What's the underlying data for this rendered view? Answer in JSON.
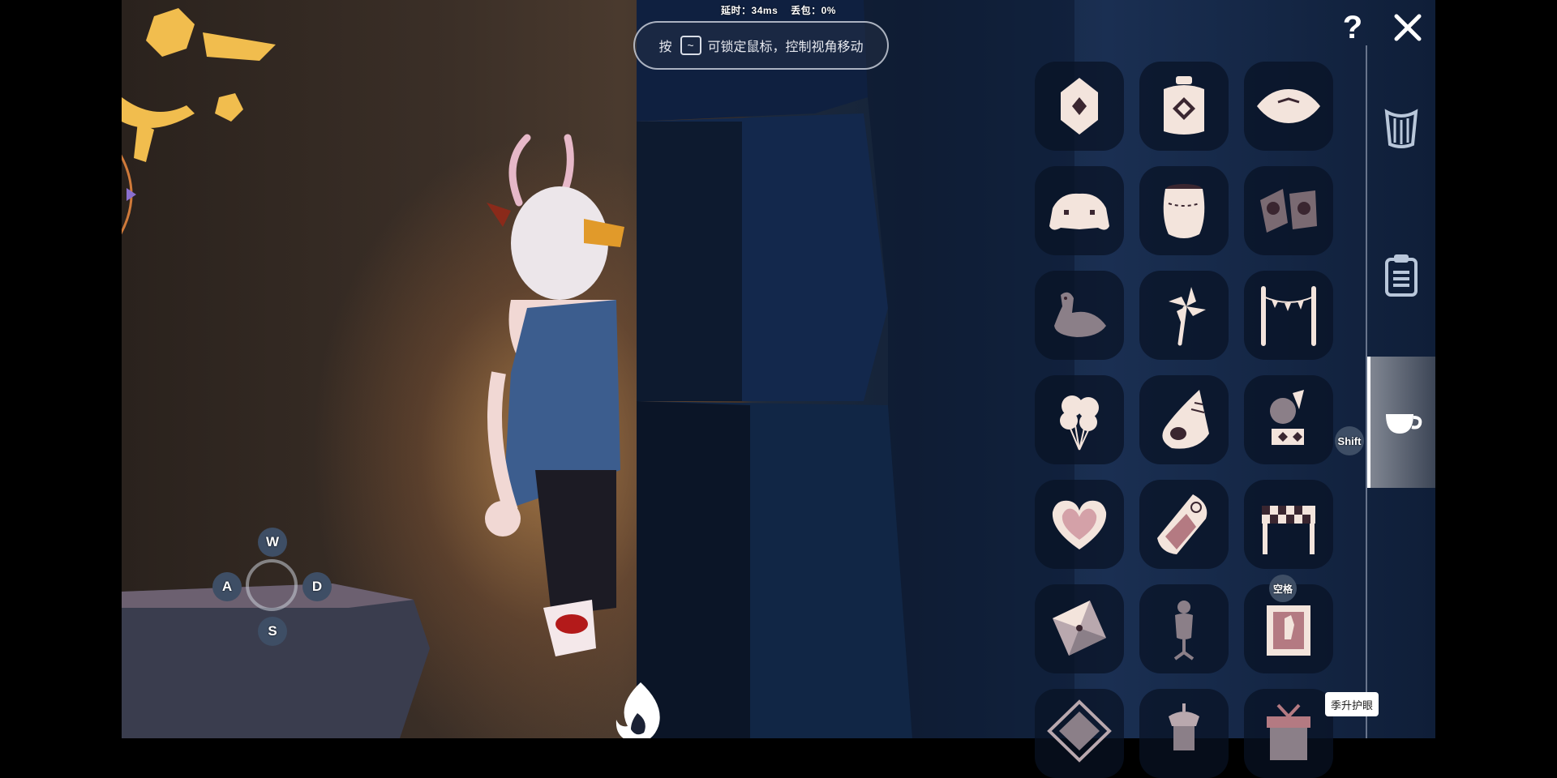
{
  "status": {
    "latency": "延时：34ms",
    "packet_loss": "丢包：0%"
  },
  "hint": {
    "prefix": "按",
    "key": "~",
    "text": "可锁定鼠标，控制视角移动"
  },
  "top_buttons": {
    "help": "?",
    "close_icon": "close-icon"
  },
  "side_tabs": [
    {
      "icon": "harp-icon",
      "active": false
    },
    {
      "icon": "clipboard-icon",
      "active": false
    },
    {
      "icon": "teacup-icon",
      "active": true
    }
  ],
  "shift_key": "Shift",
  "space_key": "空格",
  "tooltip": "季升护眼",
  "movement_keys": {
    "up": "W",
    "left": "A",
    "right": "D",
    "down": "S"
  },
  "prop_grid": [
    "diamond-tag-icon",
    "potion-bottle-icon",
    "cushion-icon",
    "tent-icon",
    "pot-icon",
    "speaker-icon",
    "bird-icon",
    "pinwheel-icon",
    "bunting-icon",
    "balloons-icon",
    "conch-icon",
    "telescope-icon",
    "heart-icon",
    "sled-icon",
    "finish-gate-icon",
    "kite-icon",
    "mannequin-icon",
    "picture-frame-icon",
    "sigil-icon",
    "lamp-icon",
    "gift-icon"
  ],
  "colors": {
    "icon_fill": "#f3e4dc",
    "icon_detail": "#3a2630",
    "slot_bg": "#08122a",
    "badge_bg": "#3e4e65"
  }
}
